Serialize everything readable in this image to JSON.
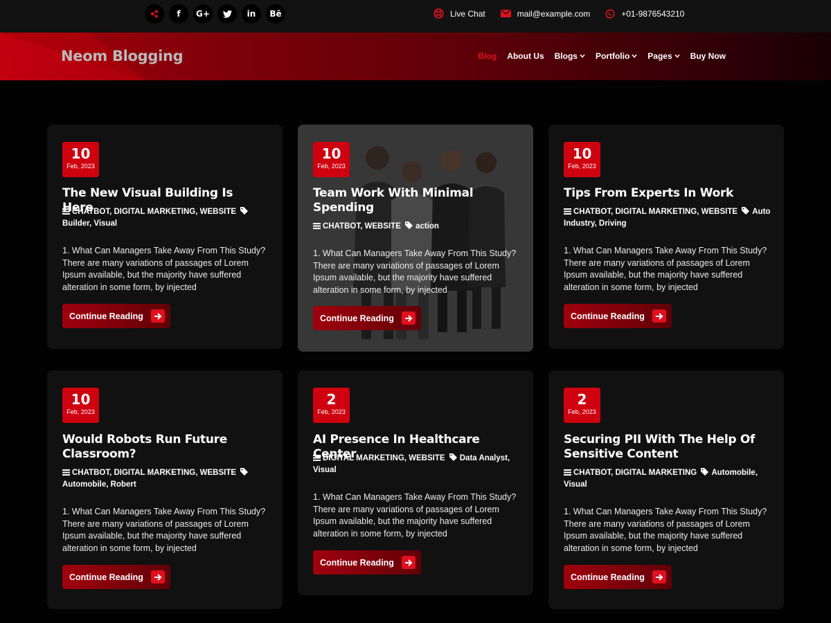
{
  "topbar": {
    "socials": [
      {
        "icon": "share-icon",
        "glyph": ""
      },
      {
        "icon": "facebook-icon",
        "glyph": "f"
      },
      {
        "icon": "google-plus-icon",
        "glyph": "G+"
      },
      {
        "icon": "twitter-icon",
        "glyph": ""
      },
      {
        "icon": "linkedin-icon",
        "glyph": "in"
      },
      {
        "icon": "behance-icon",
        "glyph": "Bē"
      }
    ],
    "live_chat": "Live Chat",
    "email": "mail@example.com",
    "phone": "+01-9876543210"
  },
  "header": {
    "brand": "Neom Blogging",
    "nav": [
      {
        "label": "Blog",
        "active": true,
        "dropdown": false
      },
      {
        "label": "About Us",
        "active": false,
        "dropdown": false
      },
      {
        "label": "Blogs",
        "active": false,
        "dropdown": true
      },
      {
        "label": "Portfolio",
        "active": false,
        "dropdown": true
      },
      {
        "label": "Pages",
        "active": false,
        "dropdown": true
      },
      {
        "label": "Buy Now",
        "active": false,
        "dropdown": false
      }
    ]
  },
  "colors": {
    "accent": "#cf000f",
    "active_nav": "#e0101e",
    "page_bg": "#020202",
    "card_bg": "#111111"
  },
  "posts": [
    {
      "day": "10",
      "month": "Feb, 2023",
      "title": "The New Visual Building Is Here",
      "categories": "CHATBOT, DIGITAL MARKETING, WEBSITE",
      "tags": "Builder, Visual",
      "excerpt": "1. What Can Managers Take Away From This Study? There are many variations of passages of Lorem Ipsum available, but the majority have suffered alteration in some form, by injected",
      "button": "Continue Reading"
    },
    {
      "day": "10",
      "month": "Feb, 2023",
      "title": "Team Work With Minimal Spending",
      "categories": "CHATBOT, WEBSITE",
      "tags": "action",
      "excerpt": "1. What Can Managers Take Away From This Study? There are many variations of passages of Lorem Ipsum available, but the majority have suffered alteration in some form, by injected",
      "button": "Continue Reading"
    },
    {
      "day": "10",
      "month": "Feb, 2023",
      "title": "Tips From Experts In Work",
      "categories": "CHATBOT, DIGITAL MARKETING, WEBSITE",
      "tags": "Auto Industry, Driving",
      "excerpt": "1. What Can Managers Take Away From This Study? There are many variations of passages of Lorem Ipsum available, but the majority have suffered alteration in some form, by injected",
      "button": "Continue Reading"
    },
    {
      "day": "10",
      "month": "Feb, 2023",
      "title": "Would Robots Run Future Classroom?",
      "categories": "CHATBOT, DIGITAL MARKETING, WEBSITE",
      "tags": "Automobile, Robert",
      "excerpt": "1. What Can Managers Take Away From This Study? There are many variations of passages of Lorem Ipsum available, but the majority have suffered alteration in some form, by injected",
      "button": "Continue Reading"
    },
    {
      "day": "2",
      "month": "Feb, 2023",
      "title": "AI Presence In Healthcare Center",
      "categories": "DIGITAL MARKETING, WEBSITE",
      "tags": "Data Analyst, Visual",
      "excerpt": "1. What Can Managers Take Away From This Study? There are many variations of passages of Lorem Ipsum available, but the majority have suffered alteration in some form, by injected",
      "button": "Continue Reading"
    },
    {
      "day": "2",
      "month": "Feb, 2023",
      "title": "Securing PII With The Help Of Sensitive Content",
      "categories": "CHATBOT, DIGITAL MARKETING",
      "tags": "Automobile, Visual",
      "excerpt": "1. What Can Managers Take Away From This Study? There are many variations of passages of Lorem Ipsum available, but the majority have suffered alteration in some form, by injected",
      "button": "Continue Reading"
    }
  ]
}
